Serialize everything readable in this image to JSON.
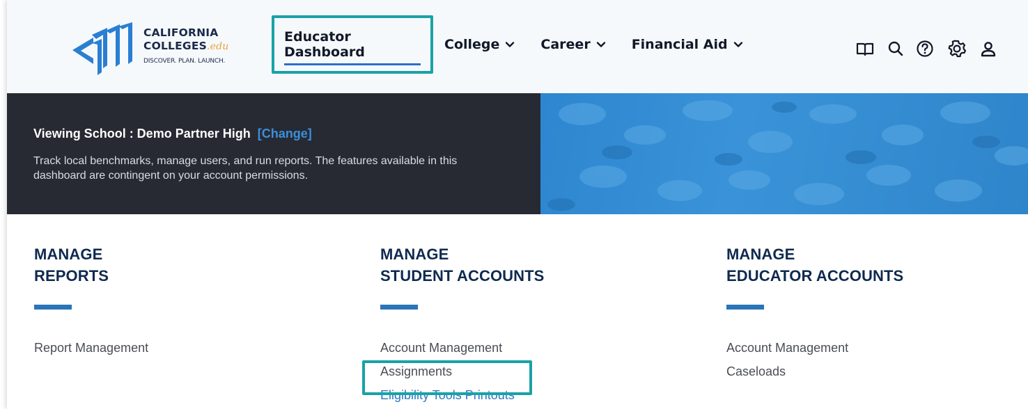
{
  "logo": {
    "line1": "CALIFORNIA",
    "line2": "COLLEGES",
    "edu": ".edu",
    "tagline": "DISCOVER. PLAN. LAUNCH."
  },
  "nav": {
    "dashboard": "Educator Dashboard",
    "college": "College",
    "career": "Career",
    "financial_aid": "Financial Aid"
  },
  "utility_icons": [
    "book-icon",
    "search-icon",
    "help-icon",
    "gear-icon",
    "user-icon"
  ],
  "hero": {
    "title": "Viewing School : Demo Partner High",
    "change": "[Change]",
    "description": "Track local benchmarks, manage users, and run reports. The features available in this dashboard are contingent on your account permissions."
  },
  "sections": {
    "reports": {
      "heading_line1": "MANAGE",
      "heading_line2": "REPORTS",
      "links": [
        "Report Management"
      ]
    },
    "students": {
      "heading_line1": "MANAGE",
      "heading_line2": "STUDENT ACCOUNTS",
      "links": [
        "Account Management",
        "Assignments",
        "Eligibility Tools Printouts"
      ]
    },
    "educators": {
      "heading_line1": "MANAGE",
      "heading_line2": "EDUCATOR ACCOUNTS",
      "links": [
        "Account Management",
        "Caseloads"
      ]
    }
  },
  "colors": {
    "highlight": "#1aa2a6",
    "accent_blue": "#2a74b8",
    "hero_dark": "#272a33",
    "link_blue": "#2d79c2"
  }
}
